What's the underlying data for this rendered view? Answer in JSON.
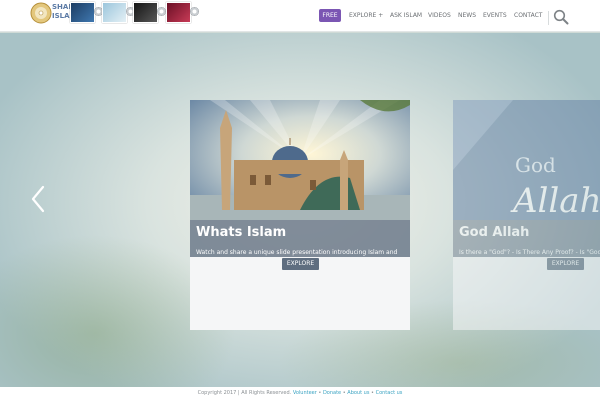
{
  "brand": {
    "logo_text_line1": "SHARE",
    "logo_text_line2": "ISLAM"
  },
  "header": {
    "thumbnails": [
      {
        "name": "dvd-thumbnail-1",
        "color": "#2e5a8a"
      },
      {
        "name": "dvd-thumbnail-2",
        "color": "#bcd7e6"
      },
      {
        "name": "dvd-thumbnail-3",
        "color": "#2b2b2b"
      },
      {
        "name": "dvd-thumbnail-4",
        "color": "#a0213c"
      }
    ]
  },
  "nav": {
    "free": "FREE",
    "explore": "EXPLORE +",
    "ask_islam": "ASK ISLAM",
    "videos": "VIDEOS",
    "news": "NEWS",
    "events": "EVENTS",
    "contact": "CONTACT"
  },
  "slides": [
    {
      "title": "Whats Islam",
      "description": "Watch and share a unique slide presentation introducing Islam and giving viewers the big picture about this life.",
      "button": "EXPLORE"
    },
    {
      "title": "God Allah",
      "image_text_1": "God",
      "image_text_2": "Allah",
      "description": "Is there a \"God\"? - Is There Any Proof? - Is \"God\" of All Prophets? - Learn About the One True",
      "button": "EXPLORE"
    }
  ],
  "footer": {
    "copyright": "Copyright 2017 | All Rights Reserved.",
    "links": [
      "Volunteer",
      "Donate",
      "About us",
      "Contact us"
    ],
    "separator": "•"
  },
  "colors": {
    "accent": "#7b56b3",
    "link": "#3aa3c2",
    "button": "#5f6e80"
  }
}
